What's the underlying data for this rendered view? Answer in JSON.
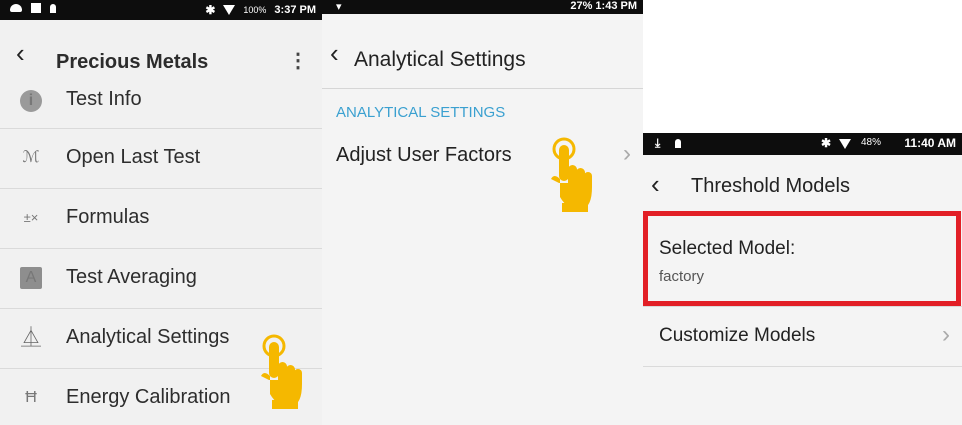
{
  "panel1": {
    "status": {
      "battery": "100%",
      "time": "3:37 PM"
    },
    "title": "Precious Metals",
    "back_icon": "chevron-left-icon",
    "menu_icon": "kebab-menu-icon",
    "items": [
      {
        "label": "Test Info",
        "icon": "info-icon",
        "icon_text": "i"
      },
      {
        "label": "Open Last Test",
        "icon": "spectrum-icon",
        "icon_text": "ℳ"
      },
      {
        "label": "Formulas",
        "icon": "formula-icon",
        "icon_text": "±×"
      },
      {
        "label": "Test Averaging",
        "icon": "averaging-icon",
        "icon_text": "A"
      },
      {
        "label": "Analytical Settings",
        "icon": "flask-icon",
        "icon_text": "⏅"
      },
      {
        "label": "Energy Calibration",
        "icon": "calibration-icon",
        "icon_text": "Ħ"
      }
    ]
  },
  "panel2": {
    "status": {
      "time": "27% 1:43 PM"
    },
    "title": "Analytical Settings",
    "section_header": "ANALYTICAL SETTINGS",
    "items": [
      {
        "label": "Adjust User Factors"
      }
    ]
  },
  "panel3": {
    "status": {
      "battery": "48%",
      "time": "11:40 AM"
    },
    "title": "Threshold Models",
    "selected_label": "Selected Model:",
    "selected_value": "factory",
    "items": [
      {
        "label": "Customize Models"
      }
    ]
  },
  "colors": {
    "accent": "#3aa0d0",
    "highlight": "#e21f26",
    "hand": "#f5b800"
  }
}
